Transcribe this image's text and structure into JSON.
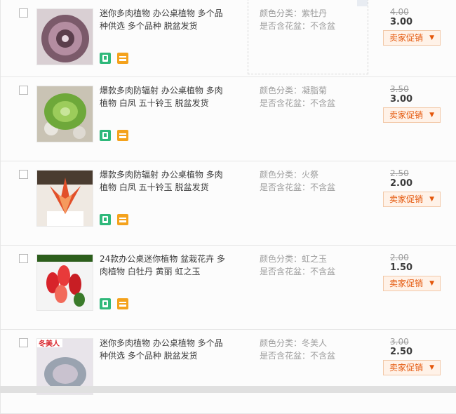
{
  "items": [
    {
      "title": "迷你多肉植物 办公桌植物 多个品种供选 多个品种 脱盆发货",
      "color_label": "颜色分类：",
      "color_value": "紫牡丹",
      "pot_label": "是否含花盆：",
      "pot_value": "不含盆",
      "price_original": "4.00",
      "price_current": "3.00",
      "promo_label": "卖家促销",
      "thumb_tag": "",
      "thumb_colors": [
        "#5e4a56",
        "#c7a7b8",
        "#e9d9e2"
      ]
    },
    {
      "title": "爆款多肉防辐射 办公桌植物 多肉植物 白凤 五十铃玉 脱盆发货",
      "color_label": "颜色分类：",
      "color_value": "凝脂菊",
      "pot_label": "是否含花盆：",
      "pot_value": "不含盆",
      "price_original": "3.50",
      "price_current": "3.00",
      "promo_label": "卖家促销",
      "thumb_tag": "",
      "thumb_colors": [
        "#6ea83a",
        "#a9d36a",
        "#d9d4c8"
      ]
    },
    {
      "title": "爆款多肉防辐射 办公桌植物 多肉植物 白凤 五十铃玉 脱盆发货",
      "color_label": "颜色分类：",
      "color_value": "火祭",
      "pot_label": "是否含花盆：",
      "pot_value": "不含盆",
      "price_original": "2.50",
      "price_current": "2.00",
      "promo_label": "卖家促销",
      "thumb_tag": "",
      "thumb_colors": [
        "#e2502a",
        "#f59a5e",
        "#e6e2dc"
      ]
    },
    {
      "title": "24款办公桌迷你植物 盆栽花卉 多肉植物 白牡丹 黄丽 虹之玉",
      "color_label": "颜色分类：",
      "color_value": "虹之玉",
      "pot_label": "是否含花盆：",
      "pot_value": "不含盆",
      "price_original": "2.00",
      "price_current": "1.50",
      "promo_label": "卖家促销",
      "thumb_tag": "",
      "thumb_colors": [
        "#d8232a",
        "#f26a5a",
        "#3a7a2a"
      ]
    },
    {
      "title": "迷你多肉植物 办公桌植物 多个品种供选 多个品种 脱盆发货",
      "color_label": "颜色分类：",
      "color_value": "冬美人",
      "pot_label": "是否含花盆：",
      "pot_value": "不含盆",
      "price_original": "3.00",
      "price_current": "2.50",
      "promo_label": "卖家促销",
      "thumb_tag": "冬美人",
      "thumb_colors": [
        "#9aa3b0",
        "#c9c2cf",
        "#e8e4ea"
      ]
    }
  ],
  "icons": {
    "service_icon_1": "green-mobile-icon",
    "service_icon_2": "orange-card-icon",
    "promo_caret": "chevron-down-icon"
  },
  "colors": {
    "promo_text": "#e4570b",
    "promo_bg": "#fff2e8",
    "border": "#e6e6e6"
  }
}
